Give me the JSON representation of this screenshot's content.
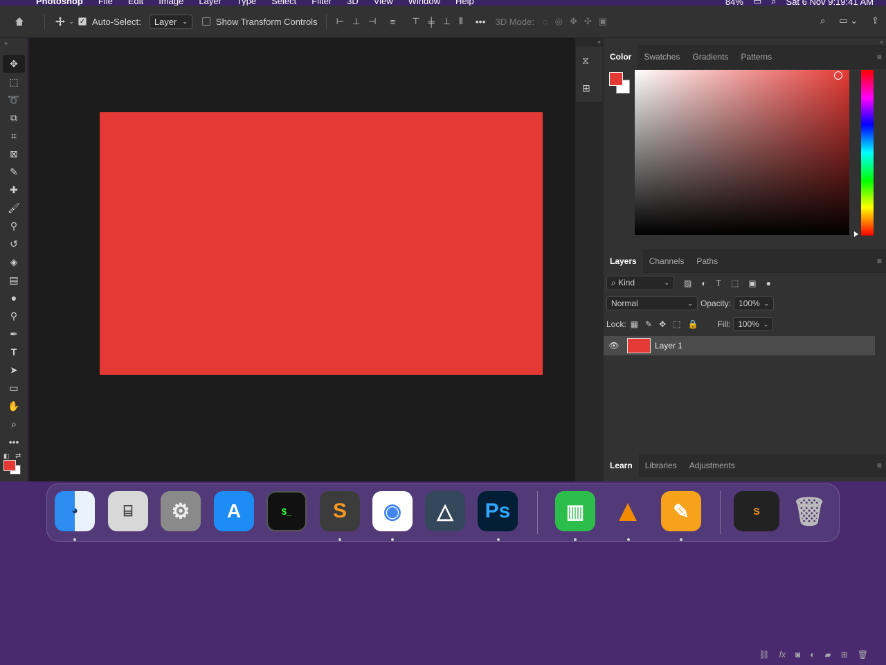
{
  "menubar": {
    "app": "Photoshop",
    "items": [
      "File",
      "Edit",
      "Image",
      "Layer",
      "Type",
      "Select",
      "Filter",
      "3D",
      "View",
      "Window",
      "Help"
    ],
    "battery": "84%",
    "clock": "Sat 6 Nov  9:19:41 AM"
  },
  "options": {
    "auto_select_label": "Auto-Select:",
    "auto_select_value": "Layer",
    "transform_label": "Show Transform Controls",
    "mode3d_label": "3D Mode:",
    "more_label": "•••"
  },
  "color_panel": {
    "tabs": [
      "Color",
      "Swatches",
      "Gradients",
      "Patterns"
    ],
    "foreground": "#e43a35",
    "background": "#ffffff"
  },
  "layers_panel": {
    "tabs": [
      "Layers",
      "Channels",
      "Paths"
    ],
    "filter_label": "Kind",
    "blend_mode": "Normal",
    "opacity_label": "Opacity:",
    "opacity_value": "100%",
    "lock_label": "Lock:",
    "fill_label": "Fill:",
    "fill_value": "100%",
    "layers": [
      {
        "name": "Layer 1",
        "color": "#e43a35"
      }
    ]
  },
  "learn_panel": {
    "tabs": [
      "Learn",
      "Libraries",
      "Adjustments"
    ]
  },
  "document": {
    "fill": "#e43a35"
  },
  "dock": {
    "ps_label": "Ps"
  }
}
